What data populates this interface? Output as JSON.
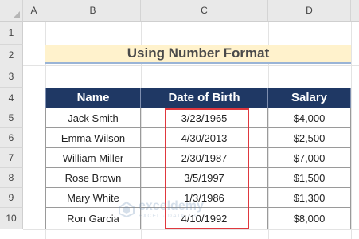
{
  "columns": [
    "A",
    "B",
    "C",
    "D"
  ],
  "rows": [
    "1",
    "2",
    "3",
    "4",
    "5",
    "6",
    "7",
    "8",
    "9",
    "10"
  ],
  "title": "Using Number Format",
  "table": {
    "headers": [
      "Name",
      "Date of Birth",
      "Salary"
    ],
    "rows": [
      [
        "Jack Smith",
        "3/23/1965",
        "$4,000"
      ],
      [
        "Emma Wilson",
        "4/30/2013",
        "$2,500"
      ],
      [
        "William Miller",
        "2/30/1987",
        "$7,000"
      ],
      [
        "Rose Brown",
        "3/5/1997",
        "$1,500"
      ],
      [
        "Mary White",
        "1/3/1986",
        "$1,300"
      ],
      [
        "Ron Garcia",
        "4/10/1992",
        "$8,000"
      ]
    ]
  },
  "highlight_color": "#e0383e",
  "header_color": "#1f3864",
  "title_fill": "#fff2cc",
  "watermark": {
    "name": "exceldemy",
    "tagline": "EXCEL · DATA · BI"
  }
}
